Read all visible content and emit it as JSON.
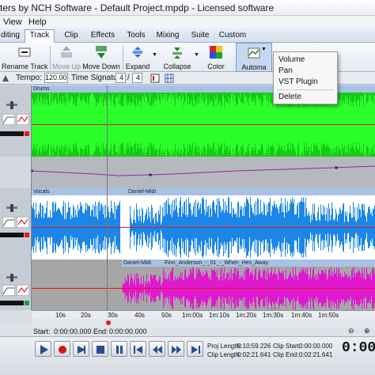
{
  "window": {
    "title": "ters by NCH Software - Default Project.mpdp - Licensed software"
  },
  "menu": [
    "View",
    "Help"
  ],
  "tabs": [
    {
      "label": "diting",
      "active": false
    },
    {
      "label": "Track",
      "active": true
    },
    {
      "label": "Clip",
      "active": false
    },
    {
      "label": "Effects",
      "active": false
    },
    {
      "label": "Tools",
      "active": false
    },
    {
      "label": "Mixing",
      "active": false
    },
    {
      "label": "Suite",
      "active": false
    },
    {
      "label": "Custom",
      "active": false
    }
  ],
  "ribbon": {
    "rename_track": "Rename Track",
    "move_up": "Move Up",
    "move_down": "Move Down",
    "expand": "Expand",
    "collapse": "Collapse",
    "color": "Color",
    "automation": "Automa"
  },
  "automation_menu": {
    "items": [
      "Volume",
      "Pan",
      "VST Plugin",
      "Delete"
    ]
  },
  "tempo": {
    "tempo_label": "Tempo:",
    "tempo_value": "120.00",
    "ts_label": "Time Signature:",
    "ts_num": "4",
    "ts_sep": "/",
    "ts_den": "4"
  },
  "tracks": [
    {
      "clips": [
        {
          "title": "Drums"
        }
      ],
      "color": "#19e619"
    },
    {
      "clips": [
        {
          "title": "Vocals"
        },
        {
          "title": "Daniel-Midi"
        }
      ],
      "color": "#1b86e8"
    },
    {
      "clips": [
        {
          "title": "Daniel-Midi"
        },
        {
          "title": "Finn_Anderson_-_01_-_When_Hes_Away"
        }
      ],
      "color": "#e019d0"
    }
  ],
  "timeline": {
    "ticks": [
      "10s",
      "20s",
      "30s",
      "40s",
      "50s",
      "1m:00s",
      "1m:10s",
      "1m:20s",
      "1m:30s",
      "1m:40s",
      "1m:50s"
    ]
  },
  "selection": {
    "start_label": "Start:",
    "start_value": "0:00:00.000",
    "end_label": "End:",
    "end_value": "0:00:00.000"
  },
  "info": {
    "proj_length_label": "Proj Length:",
    "proj_length": "0:10:59.226",
    "clip_length_label": "Clip Length:",
    "clip_length": "0:02:21.641",
    "clip_start_label": "Clip Start:",
    "clip_start": "0:00:00.000",
    "clip_end_label": "Clip End:",
    "clip_end": "0:02:21.641",
    "big_time": "0:00"
  },
  "colors": {
    "drums": "#19e619",
    "vocals": "#1b86e8",
    "finn": "#e019d0",
    "automation": "#9c1fb0",
    "volume_line": "#e01a1a"
  }
}
